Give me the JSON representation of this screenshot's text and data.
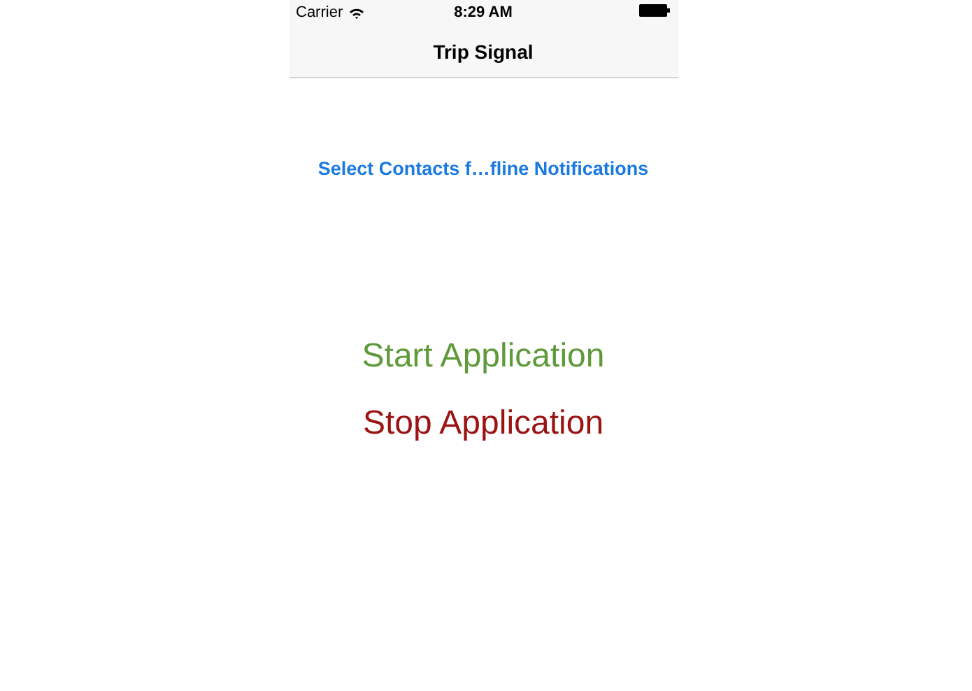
{
  "status_bar": {
    "carrier": "Carrier",
    "time": "8:29 AM"
  },
  "nav_bar": {
    "title": "Trip Signal"
  },
  "link": "Select Contacts f…fline Notifications",
  "buttons": [
    {
      "label": "Start Application",
      "kind": "start"
    },
    {
      "label": "Stop Application",
      "kind": "stop"
    }
  ]
}
